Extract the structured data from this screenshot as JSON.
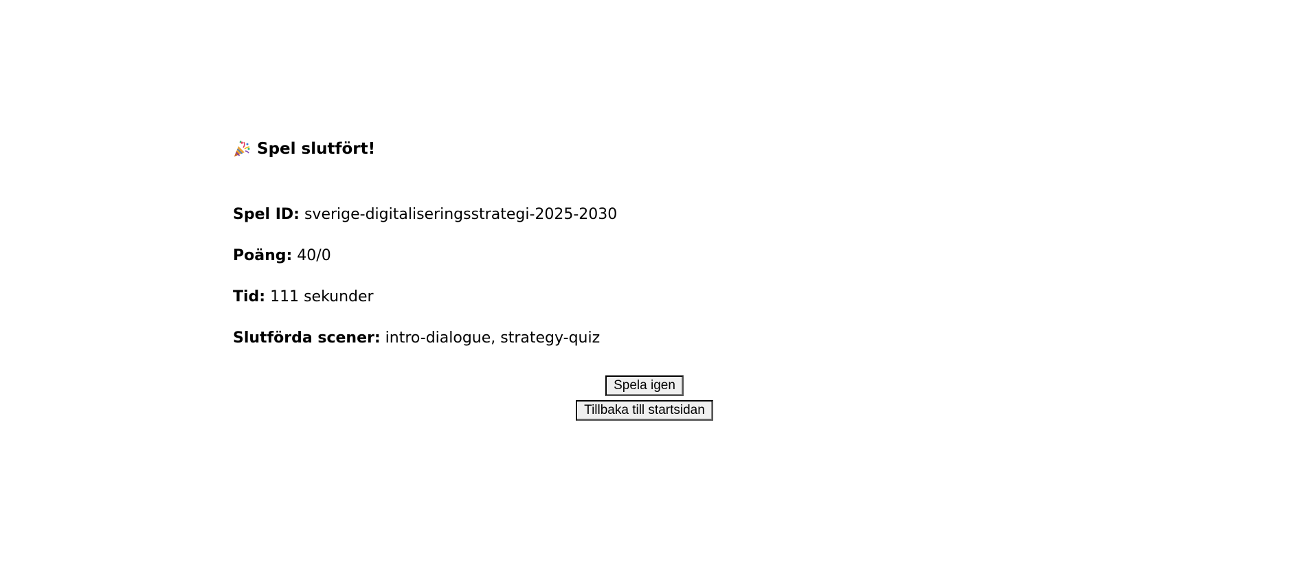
{
  "result": {
    "title_icon": "party-popper-icon",
    "title": "Spel slutfört!",
    "game_id_label": "Spel ID:",
    "game_id_value": "sverige-digitaliseringsstrategi-2025-2030",
    "score_label": "Poäng:",
    "score_value": "40/0",
    "time_label": "Tid:",
    "time_value": "111 sekunder",
    "scenes_label": "Slutförda scener:",
    "scenes_value": "intro-dialogue, strategy-quiz"
  },
  "actions": {
    "play_again_label": "Spela igen",
    "back_home_label": "Tillbaka till startsidan"
  },
  "colors": {
    "background": "#ffffff",
    "text": "#000000",
    "button_bg": "#efefef",
    "button_border": "#000000"
  }
}
